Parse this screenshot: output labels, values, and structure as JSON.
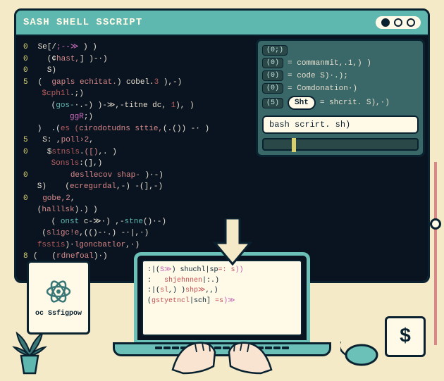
{
  "window": {
    "title": "SASH SHELL SSCRIPT"
  },
  "code": {
    "l1a": "0",
    "l1b": " Se[/",
    "l1c": ";--≫",
    "l1d": " ) )",
    "l2a": "0",
    "l2b": "   (¢",
    "l2c": "hast,",
    "l2d": "] )-·)",
    "l3a": "0",
    "l3b": "   S)",
    "l4a": "5",
    "l4b": " (  ",
    "l4c": "gapls echitat.",
    "l4d": ") cobel.",
    "l4e": "3",
    "l4f": " ),-)",
    "l5a": "    ",
    "l5b": "$cph1l",
    "l5c": ".;)",
    "l6a": "      (",
    "l6b": "gos-",
    "l6c": "·.-) )-≫,-titne dc, ",
    "l6d": "1",
    "l6e": "), )",
    "l7a": "          ",
    "l7b": "ggR",
    "l7c": ";)",
    "l8a": "   )  .(",
    "l8b": "es (",
    "l8c": "cirodotudns sttie,",
    "l8d": "(.()) -· )",
    "l9a": "5",
    "l9b": "  S: ,",
    "l9c": "poll›2",
    "l9d": ",",
    "l10a": "0",
    "l10b": "   $",
    "l10c": "stnsls",
    "l10d": ".",
    "l10e": "([)",
    "l10f": ",. )",
    "l11a": "      ",
    "l11b": "Sonsls",
    "l11c": ":(],)",
    "l12a": "0",
    "l12b": "        ",
    "l12c": "desllecov shap-",
    "l12d": " )·-)",
    "l13a": "   S)    (",
    "l13b": "ecregurdal",
    "l13c": ",-) -(],-)",
    "l14a": "0",
    "l14b": "  ",
    "l14c": "gobe,2",
    "l14d": ",",
    "l15a": "   (",
    "l15b": "halllsk",
    "l15c": ").) )",
    "l16a": "      ( ",
    "l16b": "onst",
    "l16c": " c-≫·) ,-",
    "l16d": "stne",
    "l16e": "()·-)",
    "l17a": "    (",
    "l17b": "sligc!e",
    "l17c": ",(()-·.) -·|,·)",
    "l18a": "   ",
    "l18b": "fsstis",
    "l18c": ")·",
    "l18d": "lgoncbatlor",
    "l18e": ",·)",
    "l19a": "8",
    "l19b": "(   (",
    "l19c": "rdnefoal",
    "l19d": ")·)"
  },
  "panel": {
    "tag0": "(0;)",
    "tag1": "(0)",
    "tag2": "(0)",
    "tag3": "(0)",
    "tag4": "(5)",
    "r1": "= commanmit,.1,) )",
    "r2": "= code S)·.);",
    "r3": "= Comdonation·)",
    "pill": "Sht",
    "r4": "= shcrit. S),·)",
    "input": "bash scrirt. sh)"
  },
  "card": {
    "label": "oc Ssfigpow"
  },
  "laptop": {
    "l1a": ":|(",
    "l1b": "S≫",
    "l1c": ") shuchl|sp",
    "l1d": "=: s",
    "l1e": "))",
    "l2a": ":   ",
    "l2b": "shjehnnen",
    "l2c": "|:.)",
    "l3a": ":|(",
    "l3b": "sl",
    "l3c": ",) )",
    "l3d": "shp≫",
    "l3e": ",,)",
    "l4a": "(",
    "l4b": "gstyetncl",
    "l4c": "|sch] ",
    "l4d": "=s",
    "l4e": ")≫"
  },
  "dollar": {
    "glyph": "$"
  }
}
